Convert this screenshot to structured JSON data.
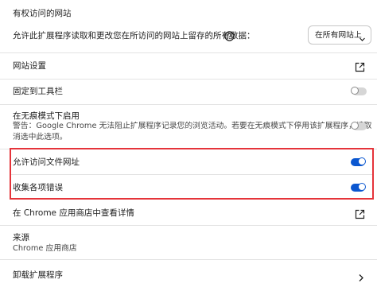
{
  "access": {
    "section_title": "有权访问的网站",
    "allow_label": "允许此扩展程序读取和更改您在所访问的网站上留存的所有数据：",
    "help_icon": "help-circle-icon",
    "select_value": "在所有网站上"
  },
  "rows": {
    "site_settings": {
      "label": "网站设置",
      "icon": "open-in-new-icon"
    },
    "pin_toolbar": {
      "label": "固定到工具栏",
      "toggle_on": false
    },
    "incognito": {
      "label": "在无痕模式下启用",
      "warning_line1": "警告：Google Chrome 无法阻止扩展程序记录您的浏览活动。若要在无痕模式下停用该扩展程序，请取",
      "warning_line2": "消选中此选项。",
      "toggle_on": false
    },
    "file_urls": {
      "label": "允许访问文件网址",
      "toggle_on": true
    },
    "collect_errors": {
      "label": "收集各项错误",
      "toggle_on": true
    },
    "webstore": {
      "label": "在 Chrome 应用商店中查看详情",
      "icon": "open-in-new-icon"
    },
    "source": {
      "label": "来源",
      "value": "Chrome 应用商店"
    },
    "uninstall": {
      "label": "卸载扩展程序",
      "icon": "chevron-right-icon"
    }
  },
  "colors": {
    "toggle_on": "#0b57d0",
    "highlight_box": "#e5343a"
  }
}
